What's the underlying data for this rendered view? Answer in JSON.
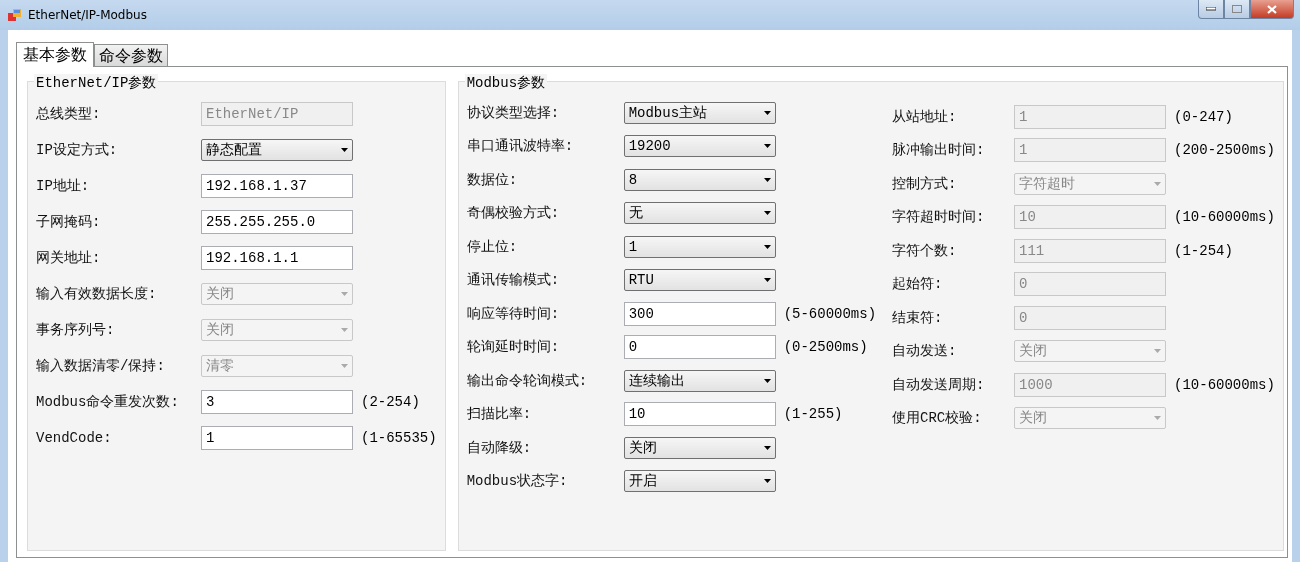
{
  "window": {
    "title": "EtherNet/IP-Modbus"
  },
  "tabs": [
    {
      "label": "基本参数",
      "selected": true
    },
    {
      "label": "命令参数",
      "selected": false
    }
  ],
  "groups": [
    {
      "title": "EtherNet/IP参数",
      "columns": [
        [
          {
            "label": "总线类型:",
            "kind": "text",
            "value": "EtherNet/IP",
            "disabled": true
          },
          {
            "label": "IP设定方式:",
            "kind": "select",
            "value": "静态配置",
            "disabled": false
          },
          {
            "label": "IP地址:",
            "kind": "text",
            "value": "192.168.1.37",
            "disabled": false
          },
          {
            "label": "子网掩码:",
            "kind": "text",
            "value": "255.255.255.0",
            "disabled": false
          },
          {
            "label": "网关地址:",
            "kind": "text",
            "value": "192.168.1.1",
            "disabled": false
          },
          {
            "label": "输入有效数据长度:",
            "kind": "select",
            "value": "关闭",
            "disabled": true
          },
          {
            "label": "事务序列号:",
            "kind": "select",
            "value": "关闭",
            "disabled": true
          },
          {
            "label": "输入数据清零/保持:",
            "kind": "select",
            "value": "清零",
            "disabled": true
          },
          {
            "label": "Modbus命令重发次数:",
            "kind": "text",
            "value": "3",
            "disabled": false,
            "hint": "(2-254)"
          },
          {
            "label": "VendCode:",
            "kind": "text",
            "value": "1",
            "disabled": false,
            "hint": "(1-65535)"
          }
        ]
      ]
    },
    {
      "title": "Modbus参数",
      "columns": [
        [
          {
            "label": "协议类型选择:",
            "kind": "select",
            "value": "Modbus主站",
            "disabled": false
          },
          {
            "label": "串口通讯波特率:",
            "kind": "select",
            "value": "19200",
            "disabled": false
          },
          {
            "label": "数据位:",
            "kind": "select",
            "value": "8",
            "disabled": false
          },
          {
            "label": "奇偶校验方式:",
            "kind": "select",
            "value": "无",
            "disabled": false
          },
          {
            "label": "停止位:",
            "kind": "select",
            "value": "1",
            "disabled": false
          },
          {
            "label": "通讯传输模式:",
            "kind": "select",
            "value": "RTU",
            "disabled": false
          },
          {
            "label": "响应等待时间:",
            "kind": "text",
            "value": "300",
            "disabled": false,
            "hint": "(5-60000ms)"
          },
          {
            "label": "轮询延时时间:",
            "kind": "text",
            "value": "0",
            "disabled": false,
            "hint": "(0-2500ms)"
          },
          {
            "label": "输出命令轮询模式:",
            "kind": "select",
            "value": "连续输出",
            "disabled": false
          },
          {
            "label": "扫描比率:",
            "kind": "text",
            "value": "10",
            "disabled": false,
            "hint": "(1-255)"
          },
          {
            "label": "自动降级:",
            "kind": "select",
            "value": "关闭",
            "disabled": false
          },
          {
            "label": "Modbus状态字:",
            "kind": "select",
            "value": "开启",
            "disabled": false
          }
        ],
        [
          {
            "label": "从站地址:",
            "kind": "text",
            "value": "1",
            "disabled": true,
            "hint": "(0-247)"
          },
          {
            "label": "脉冲输出时间:",
            "kind": "text",
            "value": "1",
            "disabled": true,
            "hint": "(200-2500ms)"
          },
          {
            "label": "控制方式:",
            "kind": "select",
            "value": "字符超时",
            "disabled": true
          },
          {
            "label": "字符超时时间:",
            "kind": "text",
            "value": "10",
            "disabled": true,
            "hint": "(10-60000ms)"
          },
          {
            "label": "字符个数:",
            "kind": "text",
            "value": "111",
            "disabled": true,
            "hint": "(1-254)"
          },
          {
            "label": "起始符:",
            "kind": "text",
            "value": "0",
            "disabled": true
          },
          {
            "label": "结束符:",
            "kind": "text",
            "value": "0",
            "disabled": true
          },
          {
            "label": "自动发送:",
            "kind": "select",
            "value": "关闭",
            "disabled": true
          },
          {
            "label": "自动发送周期:",
            "kind": "text",
            "value": "1000",
            "disabled": true,
            "hint": "(10-60000ms)"
          },
          {
            "label": "使用CRC校验:",
            "kind": "select",
            "value": "关闭",
            "disabled": true
          }
        ]
      ]
    }
  ]
}
